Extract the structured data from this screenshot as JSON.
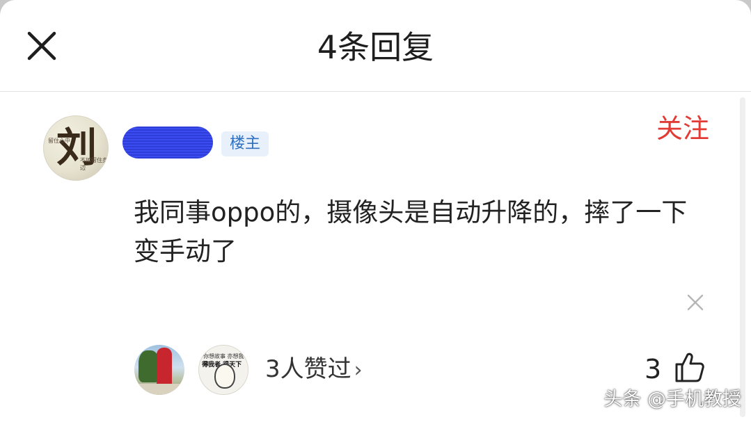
{
  "header": {
    "title": "4条回复",
    "close_icon": "close-icon"
  },
  "comment": {
    "avatar_char": "刘",
    "avatar_text_left": "留住心中",
    "avatar_text_right": "不如留住身边",
    "badge": "楼主",
    "follow_label": "关注",
    "follow_color": "#e23b35",
    "text": "我同事oppo的，摄像头是自动升降的，摔了一下变手动了",
    "dismiss_icon": "close-icon"
  },
  "likers": {
    "label": "3人赞过",
    "chevron": "›",
    "liker2_line1": "你想故事 亦想我知",
    "liker2_line2": "得我者 得天下"
  },
  "like": {
    "count": "3",
    "icon": "thumbs-up-icon"
  },
  "watermark": "头条 @手机教授"
}
